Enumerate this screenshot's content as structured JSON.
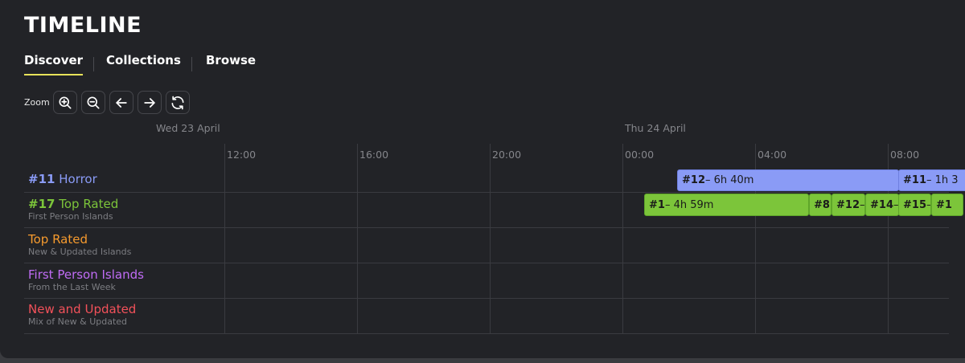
{
  "title": "TIMELINE",
  "tabs": [
    {
      "label": "Discover",
      "active": true
    },
    {
      "label": "Collections",
      "active": false
    },
    {
      "label": "Browse",
      "active": false
    }
  ],
  "controls": {
    "zoom_label": "Zoom",
    "buttons": [
      "zoom-in-icon",
      "zoom-out-icon",
      "arrow-left-icon",
      "arrow-right-icon",
      "refresh-icon"
    ]
  },
  "timeline": {
    "dates": [
      "Wed 23 April",
      "Thu 24 April"
    ],
    "hours": [
      "12:00",
      "16:00",
      "20:00",
      "00:00",
      "04:00",
      "08:00"
    ]
  },
  "rows": [
    {
      "num": "#11",
      "name": "Horror",
      "sub": "",
      "color": "#8a9bf6"
    },
    {
      "num": "#17",
      "name": "Top Rated",
      "sub": "First Person Islands",
      "color": "#7cc53a"
    },
    {
      "num": "",
      "name": "Top Rated",
      "sub": "New & Updated Islands",
      "color": "#f59a2e"
    },
    {
      "num": "",
      "name": "First Person Islands",
      "sub": "From the Last Week",
      "color": "#c06cf5"
    },
    {
      "num": "",
      "name": "New and Updated",
      "sub": "Mix of New & Updated",
      "color": "#f2515a"
    }
  ],
  "bars": [
    {
      "row": 0,
      "num": "#12",
      "text": " – 6h 40m",
      "color": "blue"
    },
    {
      "row": 0,
      "num": "#11",
      "text": " – 1h 3",
      "color": "blue"
    },
    {
      "row": 1,
      "num": "#1",
      "text": " – 4h 59m",
      "color": "green"
    },
    {
      "row": 1,
      "num": "#8",
      "text": "",
      "color": "green"
    },
    {
      "row": 1,
      "num": "#12",
      "text": " –",
      "color": "green"
    },
    {
      "row": 1,
      "num": "#14",
      "text": " –",
      "color": "green"
    },
    {
      "row": 1,
      "num": "#15",
      "text": " –",
      "color": "green"
    },
    {
      "row": 1,
      "num": "#1",
      "text": "",
      "color": "green"
    }
  ]
}
